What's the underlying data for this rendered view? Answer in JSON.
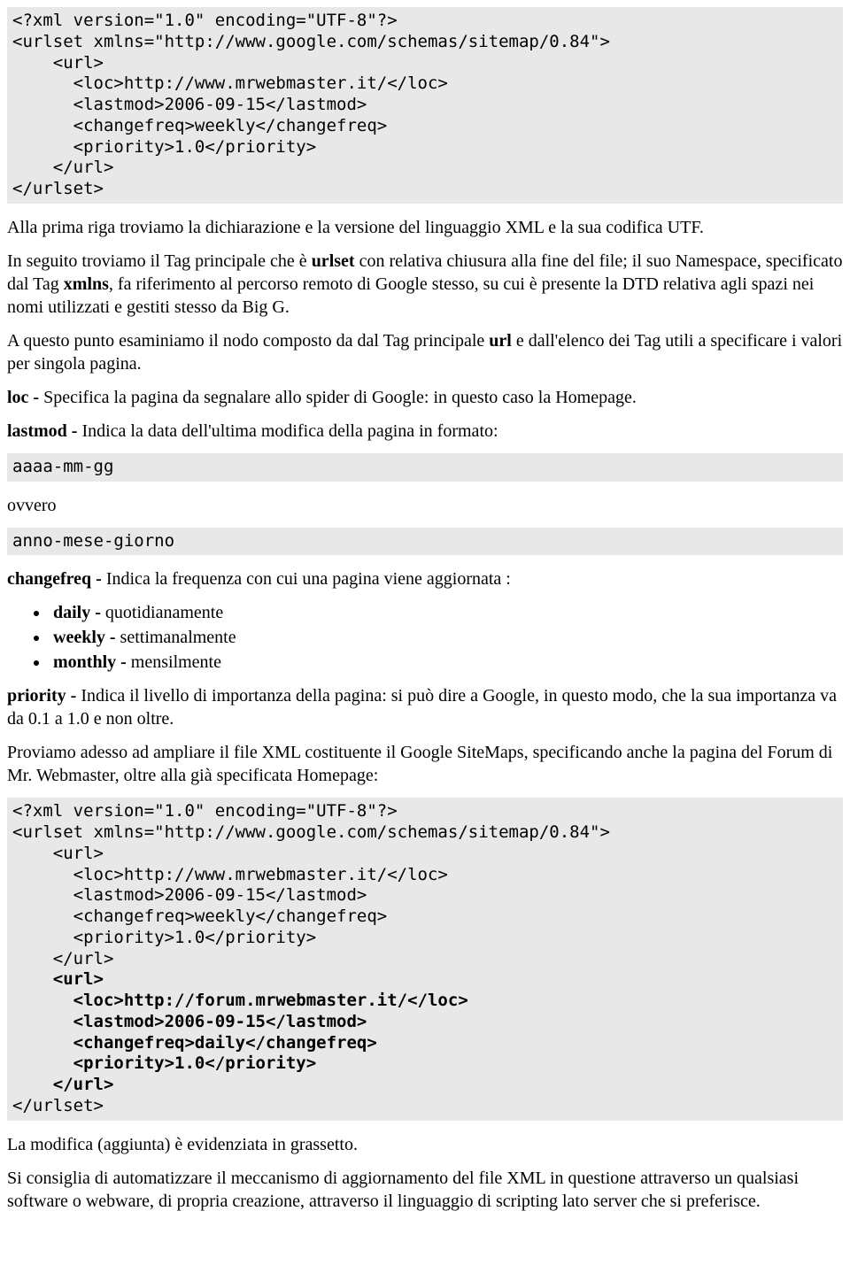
{
  "code1": "<?xml version=\"1.0\" encoding=\"UTF-8\"?>\n<urlset xmlns=\"http://www.google.com/schemas/sitemap/0.84\">\n    <url>\n      <loc>http://www.mrwebmaster.it/</loc>\n      <lastmod>2006-09-15</lastmod>\n      <changefreq>weekly</changefreq>\n      <priority>1.0</priority>\n    </url>\n</urlset>",
  "p1": "Alla prima riga troviamo la dichiarazione e la versione del linguaggio XML e la sua codifica UTF.",
  "p2_a": "In seguito troviamo il Tag principale che è ",
  "p2_b1": "urlset",
  "p2_c": " con relativa chiusura alla fine del file; il suo Namespace, specificato dal Tag ",
  "p2_b2": "xmlns",
  "p2_d": ", fa riferimento al percorso remoto di Google stesso, su cui è presente la DTD relativa agli spazi nei nomi utilizzati e gestiti stesso da Big G.",
  "p3_a": "A questo punto esaminiamo il nodo composto da dal Tag principale ",
  "p3_b1": "url",
  "p3_c": " e dall'elenco dei Tag utili a specificare i valori per singola pagina.",
  "p4_b": "loc - ",
  "p4_t": "Specifica la pagina da segnalare allo spider di Google: in questo caso la Homepage.",
  "p5_b": "lastmod - ",
  "p5_t": "Indica la data dell'ultima modifica della pagina in formato:",
  "code2": "aaaa-mm-gg",
  "p6": "ovvero",
  "code3": "anno-mese-giorno",
  "p7_b": "changefreq - ",
  "p7_t": "Indica la frequenza con cui una pagina viene aggiornata :",
  "li1_b": "daily - ",
  "li1_t": "quotidianamente",
  "li2_b": "weekly - ",
  "li2_t": "settimanalmente",
  "li3_b": "monthly - ",
  "li3_t": "mensilmente",
  "p8_b": "priority - ",
  "p8_t": "Indica il livello di importanza della pagina: si può dire a Google, in questo modo, che la sua importanza va da 0.1 a 1.0 e non oltre.",
  "p9": "Proviamo adesso ad ampliare il file XML costituente il Google SiteMaps, specificando anche la pagina del Forum di Mr. Webmaster, oltre alla già specificata Homepage:",
  "code4_plain1": "<?xml version=\"1.0\" encoding=\"UTF-8\"?>\n<urlset xmlns=\"http://www.google.com/schemas/sitemap/0.84\">\n    <url>\n      <loc>http://www.mrwebmaster.it/</loc>\n      <lastmod>2006-09-15</lastmod>\n      <changefreq>weekly</changefreq>\n      <priority>1.0</priority>\n    </url>\n",
  "code4_bold": "    <url>\n      <loc>http://forum.mrwebmaster.it/</loc>\n      <lastmod>2006-09-15</lastmod>\n      <changefreq>daily</changefreq>\n      <priority>1.0</priority>\n    </url>\n",
  "code4_plain2": "</urlset>",
  "p10": "La modifica (aggiunta) è evidenziata in grassetto.",
  "p11": "Si consiglia di automatizzare il meccanismo di aggiornamento del file XML in questione attraverso un qualsiasi software o webware, di propria creazione, attraverso il linguaggio di scripting lato server che si preferisce."
}
